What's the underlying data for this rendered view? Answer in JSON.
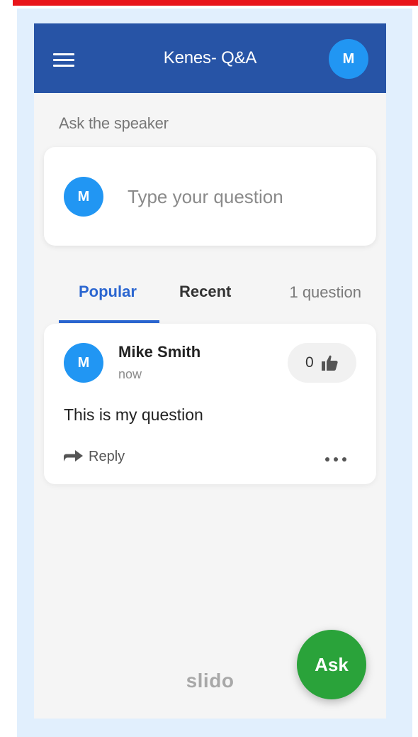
{
  "header": {
    "title": "Kenes- Q&A",
    "avatar_initial": "M"
  },
  "ask_section": {
    "label": "Ask the speaker",
    "avatar_initial": "M",
    "input_placeholder": "Type your question",
    "input_value": ""
  },
  "tabs": [
    {
      "label": "Popular",
      "active": true
    },
    {
      "label": "Recent",
      "active": false
    }
  ],
  "question_count": "1 question",
  "questions": [
    {
      "avatar_initial": "M",
      "author": "Mike Smith",
      "time": "now",
      "like_count": "0",
      "text": "This is my question",
      "reply_label": "Reply"
    }
  ],
  "brand": "slido",
  "ask_button_label": "Ask",
  "colors": {
    "header_bg": "#2754a6",
    "avatar_bg": "#2196f3",
    "active_tab": "#2b66d0",
    "ask_button": "#2aa33a",
    "top_bar": "#e8151a"
  },
  "icons": [
    "menu-icon",
    "thumbs-up-icon",
    "reply-arrow-icon",
    "more-icon"
  ]
}
